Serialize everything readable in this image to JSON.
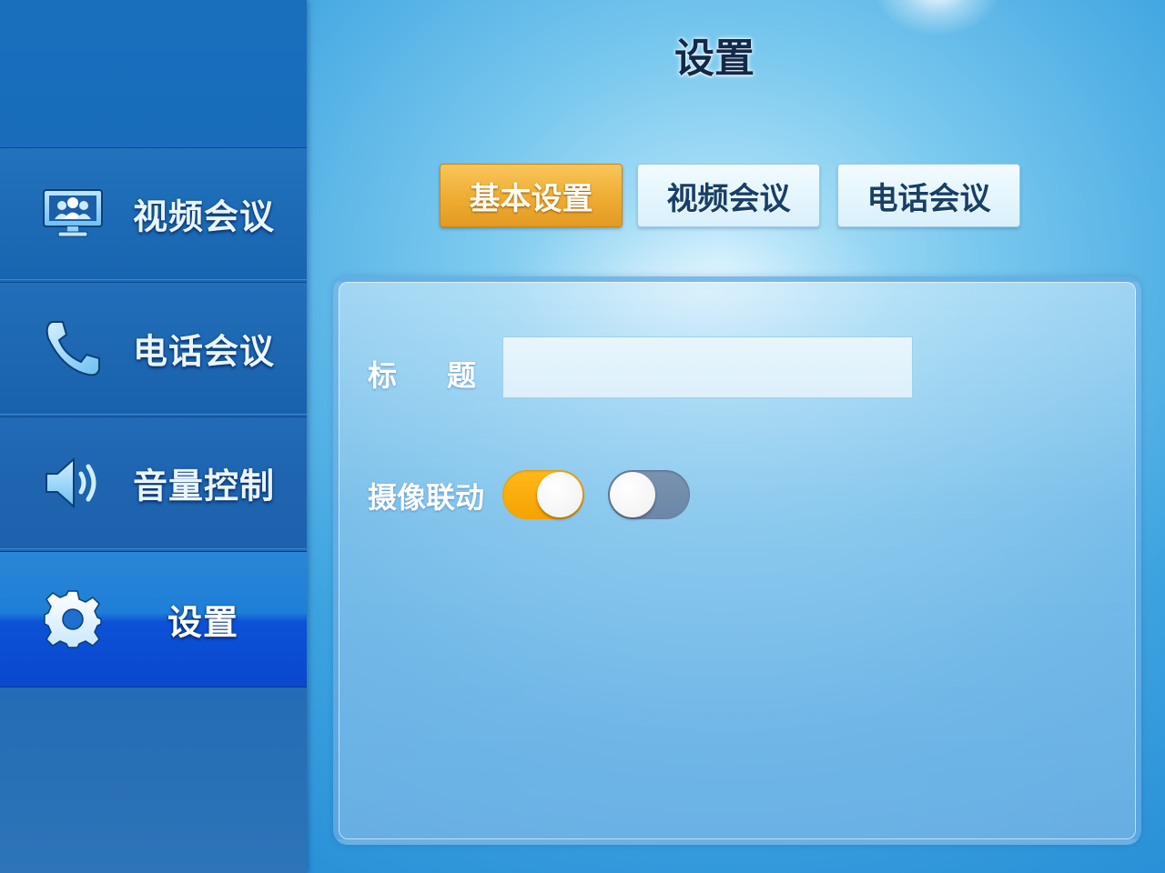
{
  "sidebar": {
    "items": [
      {
        "label": "视频会议",
        "icon": "video-conference-icon",
        "active": false
      },
      {
        "label": "电话会议",
        "icon": "phone-icon",
        "active": false
      },
      {
        "label": "音量控制",
        "icon": "speaker-icon",
        "active": false
      },
      {
        "label": "设置",
        "icon": "gear-icon",
        "active": true
      }
    ]
  },
  "header": {
    "title": "设置"
  },
  "tabs": [
    {
      "label": "基本设置",
      "active": true
    },
    {
      "label": "视频会议",
      "active": false
    },
    {
      "label": "电话会议",
      "active": false
    }
  ],
  "form": {
    "title_label_char1": "标",
    "title_label_char2": "题",
    "title_value": "",
    "camera_link_label": "摄像联动",
    "toggles": [
      {
        "state": "on",
        "color": "#f7a800"
      },
      {
        "state": "off",
        "color": "#7089a8"
      }
    ]
  },
  "colors": {
    "accent": "#eeac32",
    "sidebar": "#1a63b2",
    "active_nav": "#0c52d6"
  }
}
